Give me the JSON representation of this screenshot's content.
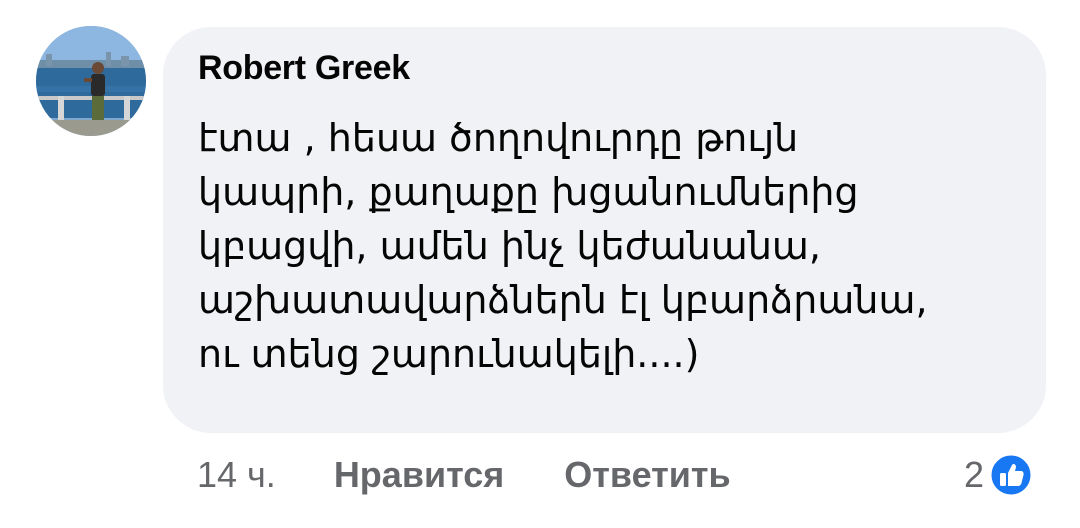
{
  "comment": {
    "author": "Robert Greek",
    "text_lines": [
      "էտա , հեսա ծողովուրդը թույն",
      "կապրի, քաղաքը խցանումներից",
      "կբացվի, ամեն ինչ կեժանանա,",
      "աշխատավարձներն էլ կբարձրանա,",
      "ու տենց շարունակելի....)"
    ]
  },
  "actions": {
    "time": "14 ч.",
    "like_label": "Нравится",
    "reply_label": "Ответить"
  },
  "reactions": {
    "count": "2",
    "icon": "like-thumbs-up-icon",
    "color": "#1877f2"
  },
  "colors": {
    "bubble_bg": "#f0f2f5",
    "text": "#050505",
    "secondary_text": "#65676b"
  }
}
